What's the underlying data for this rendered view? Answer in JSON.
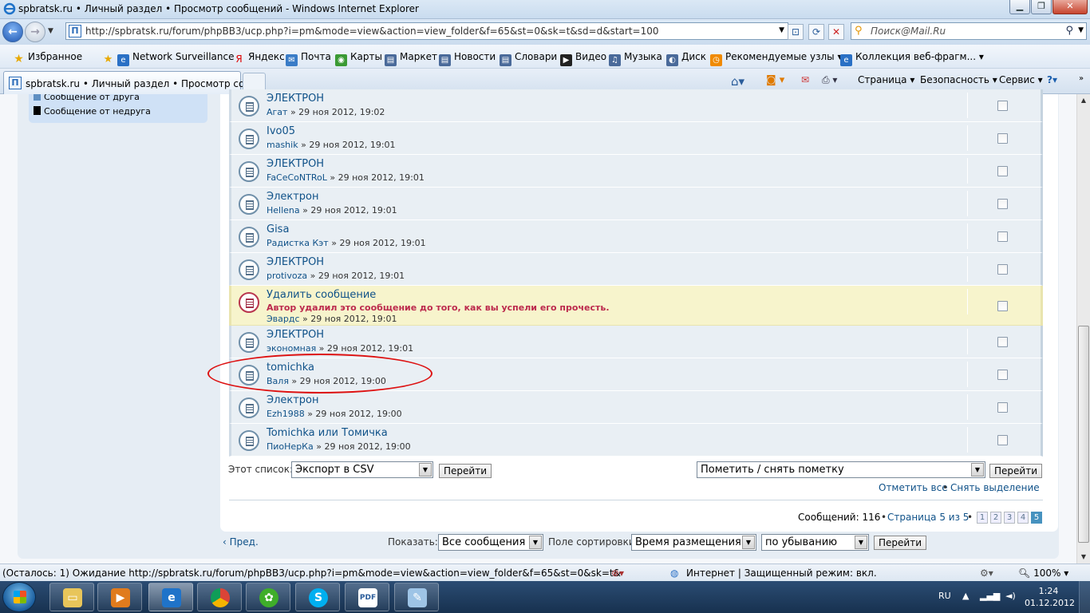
{
  "window": {
    "title": "spbratsk.ru • Личный раздел • Просмотр сообщений - Windows Internet Explorer"
  },
  "address": {
    "url": "http://spbratsk.ru/forum/phpBB3/ucp.php?i=pm&mode=view&action=view_folder&f=65&st=0&sk=t&sd=d&start=100",
    "search_placeholder": "Поиск@Mail.Ru"
  },
  "favorites": {
    "label": "Избранное",
    "items": [
      {
        "label": "Network Surveillance"
      },
      {
        "label": "Яндекс"
      },
      {
        "label": "Почта"
      },
      {
        "label": "Карты"
      },
      {
        "label": "Маркет"
      },
      {
        "label": "Новости"
      },
      {
        "label": "Словари"
      },
      {
        "label": "Видео"
      },
      {
        "label": "Музыка"
      },
      {
        "label": "Диск"
      },
      {
        "label": "Рекомендуемые узлы ▾"
      },
      {
        "label": "Коллекция веб-фрагм... ▾"
      }
    ]
  },
  "tab": {
    "title": "spbratsk.ru • Личный раздел • Просмотр сооб..."
  },
  "commandbar": {
    "page": "Страница ▾",
    "security": "Безопасность ▾",
    "service": "Сервис ▾"
  },
  "legend": {
    "friend": "Сообщение от друга",
    "foe": "Сообщение от недруга",
    "friend_color": "#5f8fc2",
    "foe_color": "#000000"
  },
  "messages": [
    {
      "subject": "ЭЛЕКТРОН",
      "author": "Агат",
      "date": " » 29 ноя 2012, 19:02"
    },
    {
      "subject": "Ivo05",
      "author": "mashik",
      "date": " » 29 ноя 2012, 19:01"
    },
    {
      "subject": "ЭЛЕКТРОН",
      "author": "FaCeCoNTRoL",
      "date": " » 29 ноя 2012, 19:01"
    },
    {
      "subject": "Электрон",
      "author": "Hellena",
      "date": " » 29 ноя 2012, 19:01"
    },
    {
      "subject": "Gisa",
      "author": "Радистка Кэт",
      "date": " » 29 ноя 2012, 19:01"
    },
    {
      "subject": "ЭЛЕКТРОН",
      "author": "protivoza",
      "date": " » 29 ноя 2012, 19:01"
    },
    {
      "subject": "Удалить сообщение",
      "warning": "Автор удалил это сообщение до того, как вы успели его прочесть.",
      "author": "Эвардс",
      "date": " » 29 ноя 2012, 19:01"
    },
    {
      "subject": "ЭЛЕКТРОН",
      "author": "экономная",
      "date": " » 29 ноя 2012, 19:01"
    },
    {
      "subject": "tomichka",
      "author": "Валя",
      "date": " » 29 ноя 2012, 19:00"
    },
    {
      "subject": "Электрон",
      "author": "Ezh1988",
      "date": " » 29 ноя 2012, 19:00"
    },
    {
      "subject": "Tomichka или Томичка",
      "author": "ПиоНерКа",
      "date": " » 29 ноя 2012, 19:00"
    }
  ],
  "export": {
    "label": "Этот список:",
    "value": "Экспорт в CSV",
    "go": "Перейти"
  },
  "mark": {
    "value": "Пометить / снять пометку",
    "go": "Перейти",
    "mark_all": "Отметить все",
    "bullet": "•",
    "unmark_all": "Снять выделение"
  },
  "pagination": {
    "messages_count": "Сообщений: 116",
    "page_of": "Страница 5 из 5",
    "pages": [
      "1",
      "2",
      "3",
      "4",
      "5"
    ],
    "current": "5"
  },
  "footer": {
    "prev": "Пред.",
    "show_label": "Показать:",
    "show_value": "Все сообщения",
    "sort_label": "Поле сортировки",
    "sort_value": "Время размещения",
    "order_value": "по убыванию",
    "go": "Перейти"
  },
  "status": {
    "loading": "(Осталось: 1) Ожидание http://spbratsk.ru/forum/phpBB3/ucp.php?i=pm&mode=view&action=view_folder&f=65&st=0&sk=t&",
    "zone": "Интернет | Защищенный режим: вкл.",
    "zoom": "100%"
  },
  "taskbar": {
    "lang": "RU",
    "time": "1:24",
    "date": "01.12.2012"
  }
}
